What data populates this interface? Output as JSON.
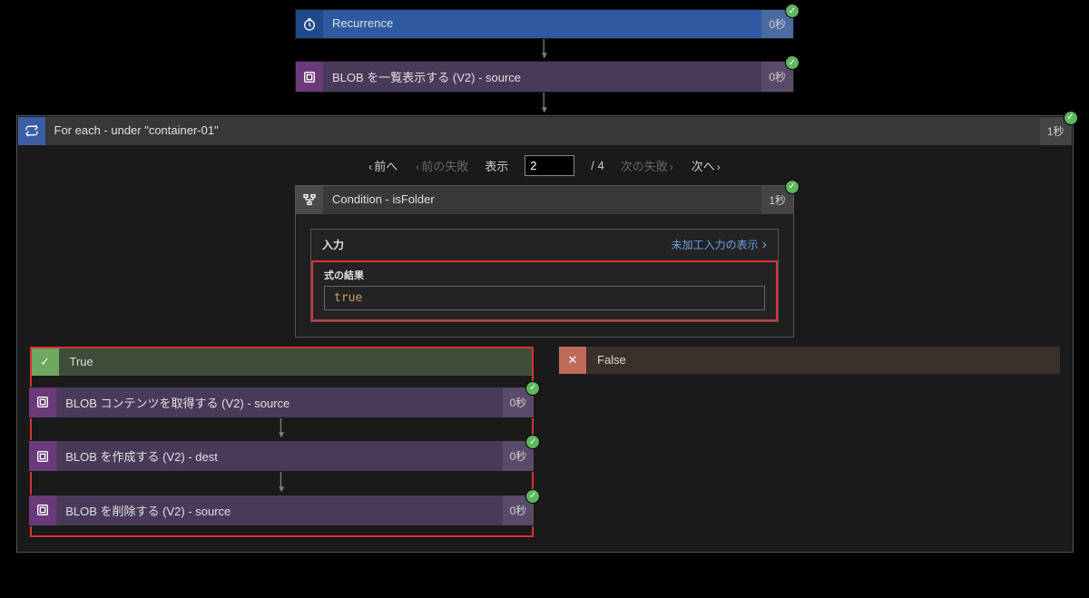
{
  "steps": {
    "recurrence": {
      "label": "Recurrence",
      "duration": "0秒"
    },
    "listBlobs": {
      "label": "BLOB を一覧表示する (V2) - source",
      "duration": "0秒"
    }
  },
  "foreach": {
    "label": "For each - under \"container-01\"",
    "duration": "1秒",
    "pager": {
      "prev": "前へ",
      "prevFail": "前の失敗",
      "displayLabel": "表示",
      "current": "2",
      "total": "/ 4",
      "nextFail": "次の失敗",
      "next": "次へ"
    },
    "condition": {
      "label": "Condition - isFolder",
      "duration": "1秒",
      "inputLabel": "入力",
      "rawInputLink": "未加工入力の表示",
      "resultLabel": "式の結果",
      "resultValue": "true"
    },
    "branches": {
      "true": {
        "label": "True",
        "steps": [
          {
            "label": "BLOB コンテンツを取得する (V2) - source",
            "duration": "0秒"
          },
          {
            "label": "BLOB を作成する (V2) - dest",
            "duration": "0秒"
          },
          {
            "label": "BLOB を削除する (V2) - source",
            "duration": "0秒"
          }
        ]
      },
      "false": {
        "label": "False"
      }
    }
  }
}
